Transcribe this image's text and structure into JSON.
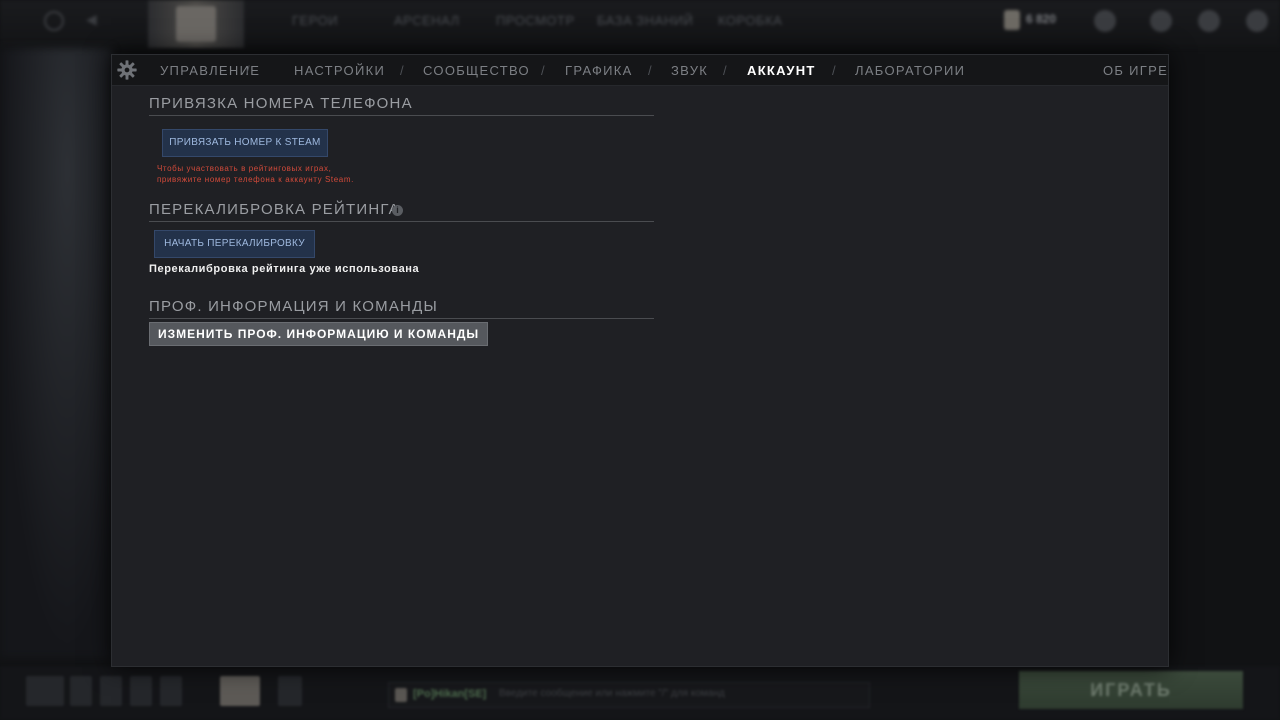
{
  "background": {
    "top_nav": [
      "ГЕРОИ",
      "АРСЕНАЛ",
      "ПРОСМОТР",
      "БАЗА ЗНАНИЙ",
      "КОРОБКА"
    ],
    "currency_amount": "6 820",
    "play_button": "ИГРАТЬ",
    "chat_name": "[Po]Hikan[SE]",
    "chat_hint": "Введите сообщение или нажмите \"/\" для команд"
  },
  "settings": {
    "tabs": [
      {
        "label": "УПРАВЛЕНИЕ",
        "active": false
      },
      {
        "label": "НАСТРОЙКИ",
        "active": false
      },
      {
        "label": "СООБЩЕСТВО",
        "active": false
      },
      {
        "label": "ГРАФИКА",
        "active": false
      },
      {
        "label": "ЗВУК",
        "active": false
      },
      {
        "label": "АККАУНТ",
        "active": true
      },
      {
        "label": "ЛАБОРАТОРИИ",
        "active": false
      }
    ],
    "separator": "/",
    "about_label": "ОБ ИГРЕ"
  },
  "account": {
    "phone": {
      "title": "ПРИВЯЗКА НОМЕРА ТЕЛЕФОНА",
      "button": "ПРИВЯЗАТЬ НОМЕР К STEAM",
      "warning": "Чтобы участвовать в рейтинговых играх, привяжите номер телефона к аккаунту Steam."
    },
    "recalibration": {
      "title": "ПЕРЕКАЛИБРОВКА РЕЙТИНГА",
      "info_icon": "i",
      "button": "НАЧАТЬ ПЕРЕКАЛИБРОВКУ",
      "status": "Перекалибровка рейтинга уже использована"
    },
    "pro": {
      "title": "ПРОФ. ИНФОРМАЦИЯ И КОМАНДЫ",
      "button": "ИЗМЕНИТЬ ПРОФ. ИНФОРМАЦИЮ И КОМАНДЫ"
    }
  },
  "colors": {
    "panel_bg": "#1f2024",
    "tab_active": "#ffffff",
    "warning": "#d24a3a",
    "blue_button": "#23324a"
  }
}
